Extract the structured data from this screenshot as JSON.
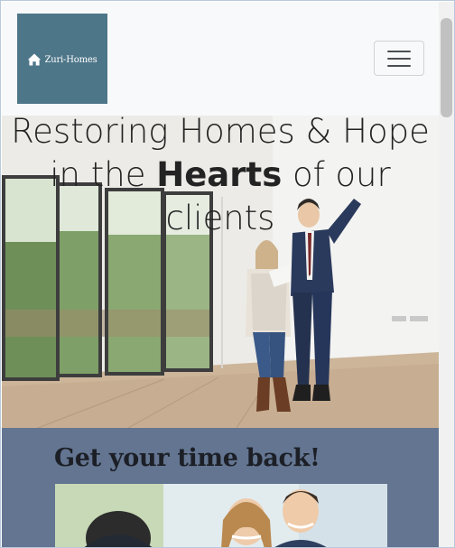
{
  "navbar": {
    "brand": {
      "name": "Zuri-Homes",
      "icon": "house-icon",
      "bg_color": "#4e7689"
    },
    "toggler": {
      "icon": "hamburger-icon"
    }
  },
  "hero": {
    "title_part1": "Restoring Homes & Hope in the ",
    "title_bold": "Hearts",
    "title_part2": " of our clients",
    "image": "couple-viewing-empty-house-photo"
  },
  "feature_section": {
    "title": "Get your time back!",
    "bg_color": "#637591",
    "image": "smiling-couple-with-advisor-photo"
  }
}
